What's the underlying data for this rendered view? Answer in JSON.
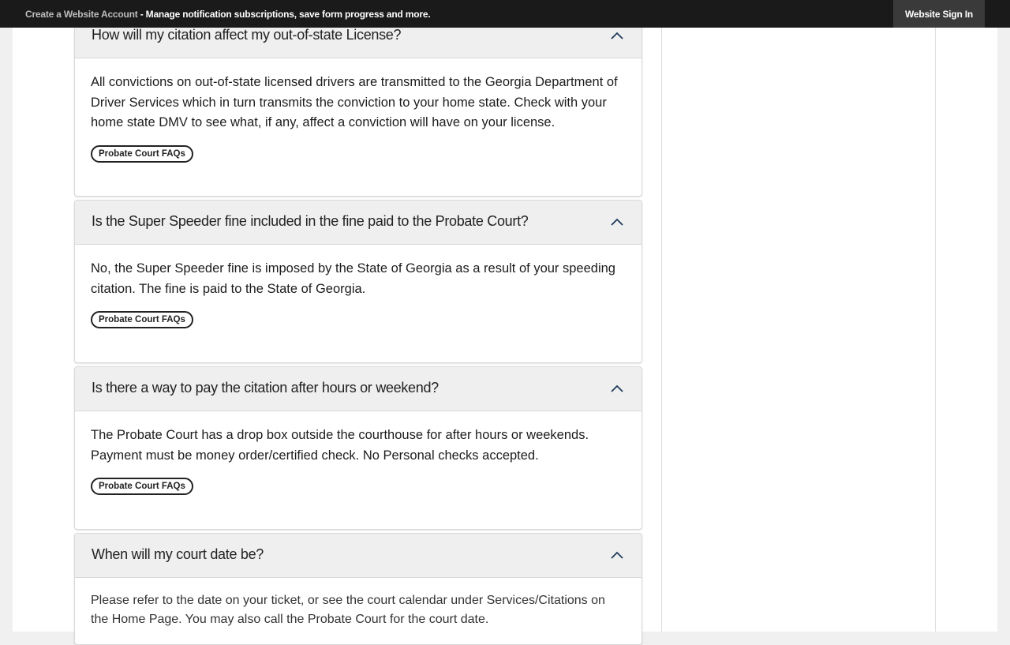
{
  "topbar": {
    "create_account_link": "Create a Website Account",
    "description": " - Manage notification subscriptions, save form progress and more.",
    "sign_in_button": "Website Sign In"
  },
  "faqs": [
    {
      "question": "How will my citation affect my out-of-state License?",
      "answer": "All convictions on out-of-state licensed drivers are transmitted to the Georgia Department of Driver Services which in turn transmits the conviction to your home state. Check with your home state DMV to see what, if any, affect a conviction will have  on your license.",
      "tag": "Probate Court FAQs"
    },
    {
      "question": "Is the Super Speeder fine included in the fine paid to the Probate Court?",
      "answer": "No, the Super Speeder fine is imposed by the State of Georgia as a result of your speeding citation.  The fine is paid to the State of Georgia.",
      "tag": "Probate Court FAQs"
    },
    {
      "question": "Is there a way to pay the citation after hours or weekend?",
      "answer": "The Probate Court has a drop box outside the courthouse for after hours or weekends.  Payment must be money order/certified check.  No Personal checks accepted.",
      "tag": "Probate Court FAQs"
    },
    {
      "question": "When will my court date be?",
      "answer": "Please refer to the date on your ticket, or see the court calendar under Services/Citations on the Home Page. You may also call the Probate Court for the court date.",
      "tag": ""
    }
  ]
}
